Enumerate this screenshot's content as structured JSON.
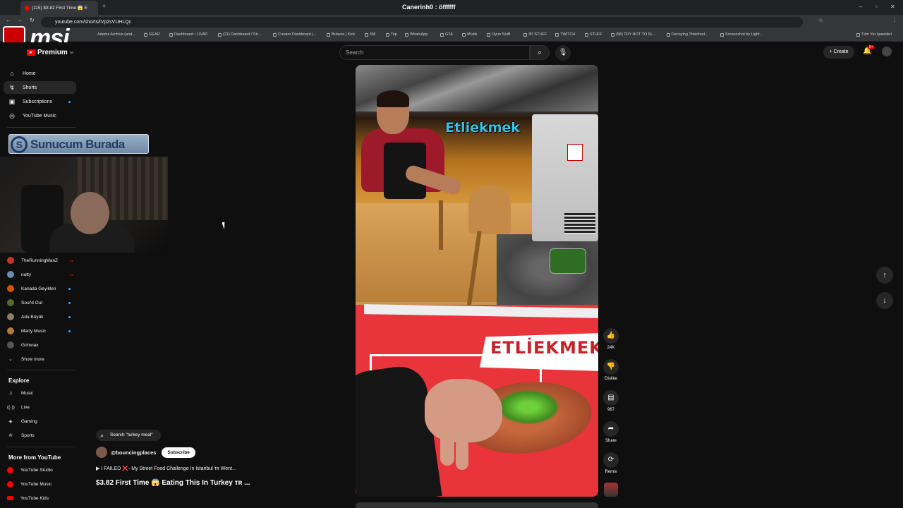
{
  "browser": {
    "tab_title": "(115) $3.82 First Time 😱 E",
    "url": "youtube.com/shorts/lVp2sVUHLQc",
    "window_title": "Canerinh0 : öffffff",
    "bookmarks": [
      "Adams Archive (and...",
      "GEAR",
      "Dashboard • LIVAD",
      "(21) Dashboard / Str...",
      "Creator Dashboard |...",
      "Browse | Kick",
      "SM",
      "Top",
      "WhatsApp",
      "GTA",
      "Müzik",
      "Oyun Stuff",
      "3D STUFF",
      "TWITCH",
      "STUFF",
      "(98) TRY NOT TO SL...",
      "Decaying Thatched...",
      "Screenshot by Light..."
    ],
    "bookmarks_right": "Tüm Yer İşaretleri"
  },
  "overlay": {
    "msi_logo": "msi",
    "sunucum_text": "Sunucum Burada"
  },
  "header": {
    "logo_label": "Premium",
    "logo_region": "TR",
    "search_placeholder": "Search",
    "create_label": "Create",
    "notif_badge": "9+"
  },
  "sidebar": {
    "main": [
      {
        "label": "Home",
        "icon": "home-icon"
      },
      {
        "label": "Shorts",
        "icon": "shorts-icon"
      },
      {
        "label": "Subscriptions",
        "icon": "subscriptions-icon"
      },
      {
        "label": "YouTube Music",
        "icon": "music-icon"
      }
    ],
    "subscriptions": [
      {
        "label": "TheRunningManZ",
        "color": "#c0392b"
      },
      {
        "label": "nutty",
        "color": "#6a8cae"
      },
      {
        "label": "Kanada Geyikleri",
        "color": "#d35400"
      },
      {
        "label": "Soul'd Out",
        "color": "#556b2f"
      },
      {
        "label": "Ada Büyük",
        "color": "#8e7d6b"
      },
      {
        "label": "Marty Music",
        "color": "#b07d3c"
      },
      {
        "label": "Grimnax",
        "color": "#555555"
      }
    ],
    "show_more": "Show more",
    "explore_title": "Explore",
    "explore": [
      {
        "label": "Music",
        "icon": "music-note-icon"
      },
      {
        "label": "Live",
        "icon": "live-icon"
      },
      {
        "label": "Gaming",
        "icon": "gaming-icon"
      },
      {
        "label": "Sports",
        "icon": "trophy-icon"
      }
    ],
    "more_title": "More from YouTube",
    "more": [
      {
        "label": "YouTube Studio"
      },
      {
        "label": "YouTube Music"
      },
      {
        "label": "YouTube Kids"
      }
    ]
  },
  "video": {
    "caption": "Etliekmek",
    "banner_text": "ETLİEKMEK",
    "search_chip": "Search \"turkey meal\"",
    "channel": "@bouncingplaces",
    "subscribe": "Subscribe",
    "related": "▶ I FAILED ❌- My Street Food Challenge In Istanbul ᴛʀ Went...",
    "title": "$3.82 First Time 😱  Eating This In Turkey ᴛʀ ..."
  },
  "actions": {
    "like_count": "24K",
    "dislike_label": "Dislike",
    "comment_count": "967",
    "share_label": "Share",
    "remix_label": "Remix"
  }
}
